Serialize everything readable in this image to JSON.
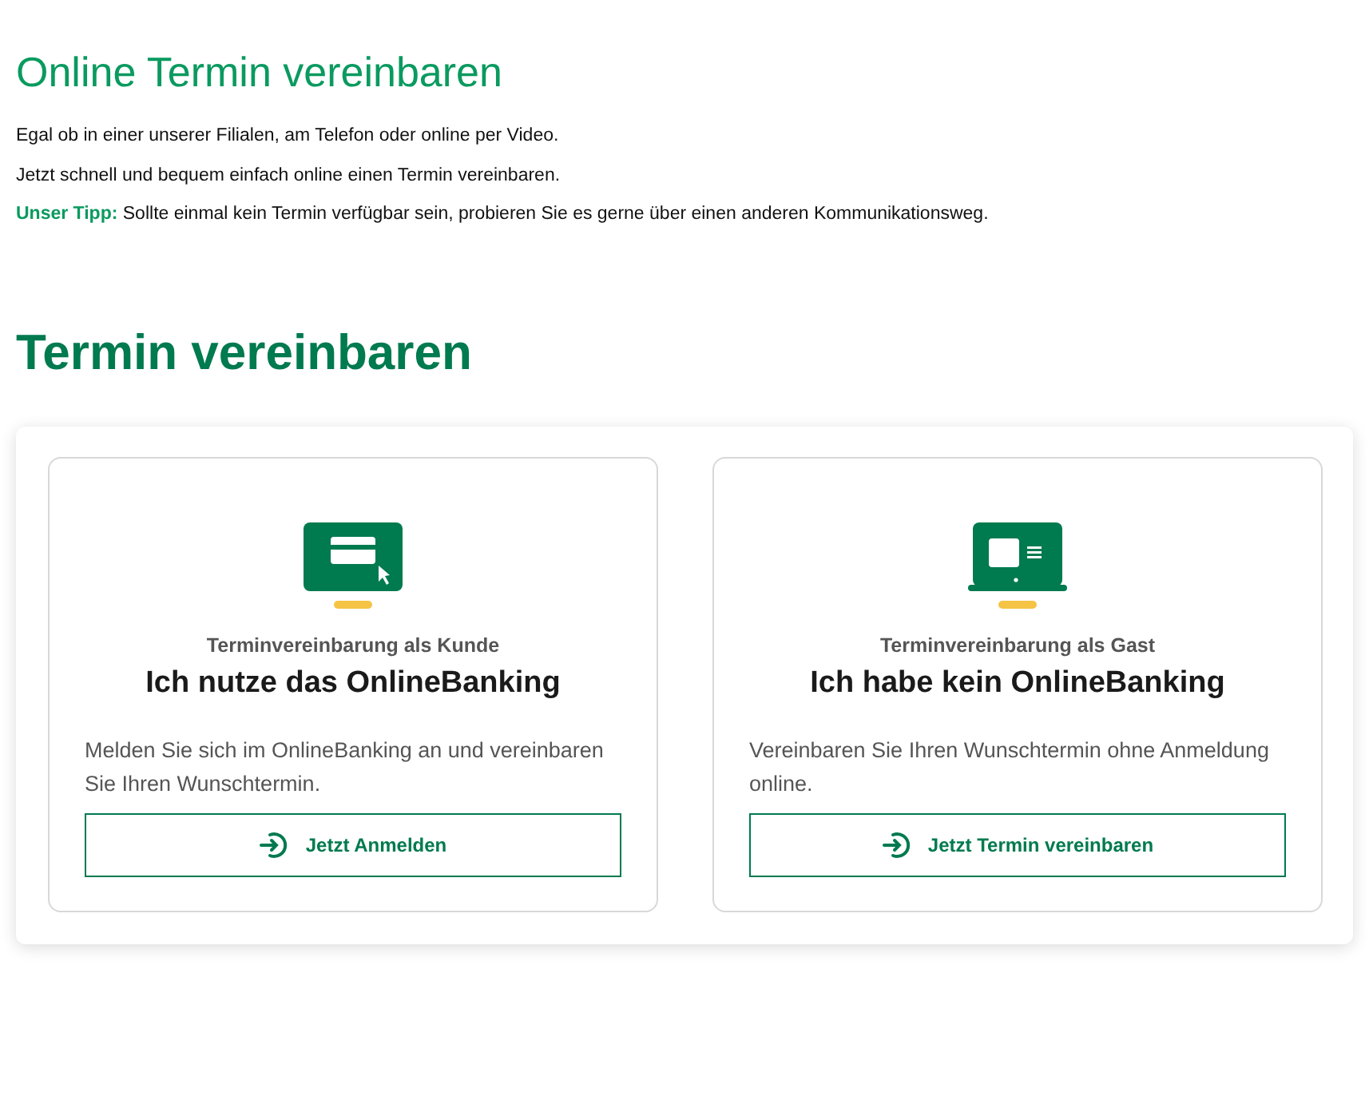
{
  "intro": {
    "title": "Online Termin vereinbaren",
    "paragraphs": [
      "Egal ob in einer unserer Filialen, am Telefon oder online per Video.",
      "Jetzt schnell und bequem einfach online einen Termin vereinbaren."
    ],
    "tip": {
      "label": "Unser Tipp:",
      "text": "Sollte einmal kein Termin verfügbar sein, probieren Sie es gerne über einen anderen Kommunikationsweg."
    }
  },
  "section": {
    "title": "Termin vereinbaren",
    "cards": [
      {
        "kind": "monitor",
        "eyebrow": "Terminvereinbarung als Kunde",
        "title": "Ich nutze das OnlineBanking",
        "text": "Melden Sie sich im OnlineBanking an und vereinbaren Sie Ihren Wunschtermin.",
        "button": "Jetzt Anmelden"
      },
      {
        "kind": "laptop",
        "eyebrow": "Terminvereinbarung als Gast",
        "title": "Ich habe kein OnlineBanking",
        "text": "Vereinbaren Sie Ihren Wunschtermin ohne Anmeldung online.",
        "button": "Jetzt Termin vereinbaren"
      }
    ]
  }
}
